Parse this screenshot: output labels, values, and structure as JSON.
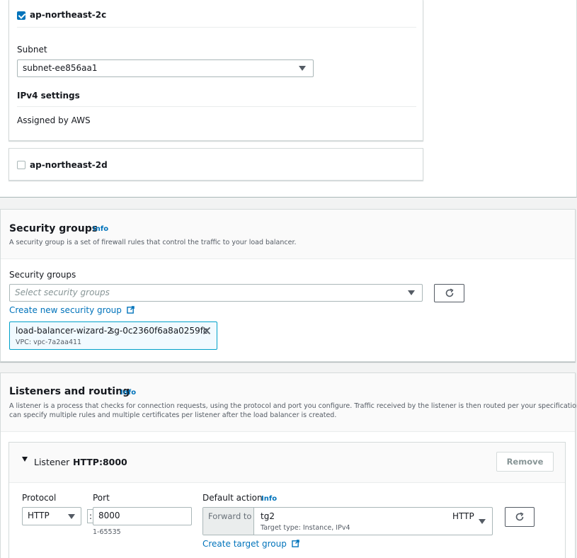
{
  "availability_zones": [
    {
      "name": "ap-northeast-2c",
      "checked": true,
      "subnet_label": "Subnet",
      "subnet_value": "subnet-ee856aa1",
      "ipv4_heading": "IPv4 settings",
      "ipv4_value": "Assigned by AWS"
    },
    {
      "name": "ap-northeast-2d",
      "checked": false
    }
  ],
  "security_groups": {
    "title": "Security groups",
    "info": "Info",
    "description": "A security group is a set of firewall rules that control the traffic to your load balancer.",
    "field_label": "Security groups",
    "placeholder": "Select security groups",
    "create_link": "Create new security group",
    "selected": [
      {
        "name": "load-balancer-wizard-2",
        "id": "sg-0c2360f6a8a0259fc",
        "vpc": "VPC: vpc-7a2aa411"
      }
    ]
  },
  "listeners": {
    "title": "Listeners and routing",
    "info": "Info",
    "description_line1": "A listener is a process that checks for connection requests, using the protocol and port you configure. Traffic received by the listener is then routed per your specification. You",
    "description_line2": "can specify multiple rules and multiple certificates per listener after the load balancer is created.",
    "listener": {
      "label": "Listener",
      "name": "HTTP:8000",
      "remove_label": "Remove",
      "protocol_label": "Protocol",
      "protocol_value": "HTTP",
      "port_label": "Port",
      "port_value": "8000",
      "port_hint": "1-65535",
      "separator": ":",
      "default_action_label": "Default action",
      "default_action_info": "Info",
      "forward_to": "Forward to",
      "target_group": "tg2",
      "target_protocol": "HTTP",
      "target_type": "Target type: Instance, IPv4",
      "create_target_link": "Create target group"
    }
  },
  "colors": {
    "link": "#0073bb",
    "selected_border": "#00a1c9",
    "token_bg": "#f1faff"
  }
}
